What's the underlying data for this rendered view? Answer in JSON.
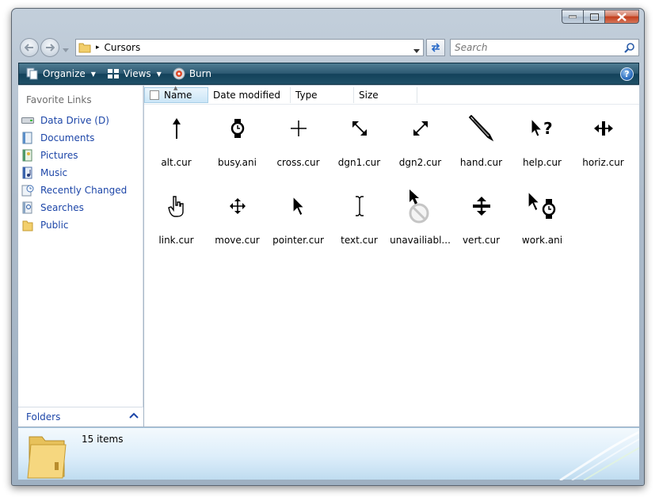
{
  "window": {
    "title_buttons": [
      "minimize-icon",
      "maximize-icon",
      "close-icon"
    ]
  },
  "address": {
    "path_separator": "▸",
    "current_folder": "Cursors"
  },
  "search": {
    "placeholder": "Search"
  },
  "toolbar": {
    "organize": "Organize",
    "views": "Views",
    "burn": "Burn",
    "help": "?"
  },
  "sidebar": {
    "header": "Favorite Links",
    "items": [
      {
        "label": "Data Drive (D)",
        "icon": "drive-icon"
      },
      {
        "label": "Documents",
        "icon": "documents-icon"
      },
      {
        "label": "Pictures",
        "icon": "pictures-icon"
      },
      {
        "label": "Music",
        "icon": "music-icon"
      },
      {
        "label": "Recently Changed",
        "icon": "recent-icon"
      },
      {
        "label": "Searches",
        "icon": "searches-icon"
      },
      {
        "label": "Public",
        "icon": "public-folder-icon"
      }
    ],
    "folders_label": "Folders"
  },
  "columns": [
    "Name",
    "Date modified",
    "Type",
    "Size"
  ],
  "files": [
    {
      "name": "alt.cur",
      "icon": "arrow-up-cursor-icon"
    },
    {
      "name": "busy.ani",
      "icon": "hourglass-watch-cursor-icon"
    },
    {
      "name": "cross.cur",
      "icon": "crosshair-cursor-icon"
    },
    {
      "name": "dgn1.cur",
      "icon": "resize-nwse-cursor-icon"
    },
    {
      "name": "dgn2.cur",
      "icon": "resize-nesw-cursor-icon"
    },
    {
      "name": "hand.cur",
      "icon": "pen-cursor-icon"
    },
    {
      "name": "help.cur",
      "icon": "help-cursor-icon"
    },
    {
      "name": "horiz.cur",
      "icon": "resize-horizontal-cursor-icon"
    },
    {
      "name": "link.cur",
      "icon": "hand-pointer-cursor-icon"
    },
    {
      "name": "move.cur",
      "icon": "move-cursor-icon"
    },
    {
      "name": "pointer.cur",
      "icon": "arrow-cursor-icon"
    },
    {
      "name": "text.cur",
      "icon": "text-beam-cursor-icon"
    },
    {
      "name": "unavailiabl...",
      "icon": "unavailable-cursor-icon"
    },
    {
      "name": "vert.cur",
      "icon": "resize-vertical-cursor-icon"
    },
    {
      "name": "work.ani",
      "icon": "working-cursor-icon"
    }
  ],
  "status": {
    "item_count": "15 items"
  },
  "colors": {
    "link": "#1d46a8",
    "toolbar": "#1f5067",
    "details_pane": "#ddeefa"
  }
}
